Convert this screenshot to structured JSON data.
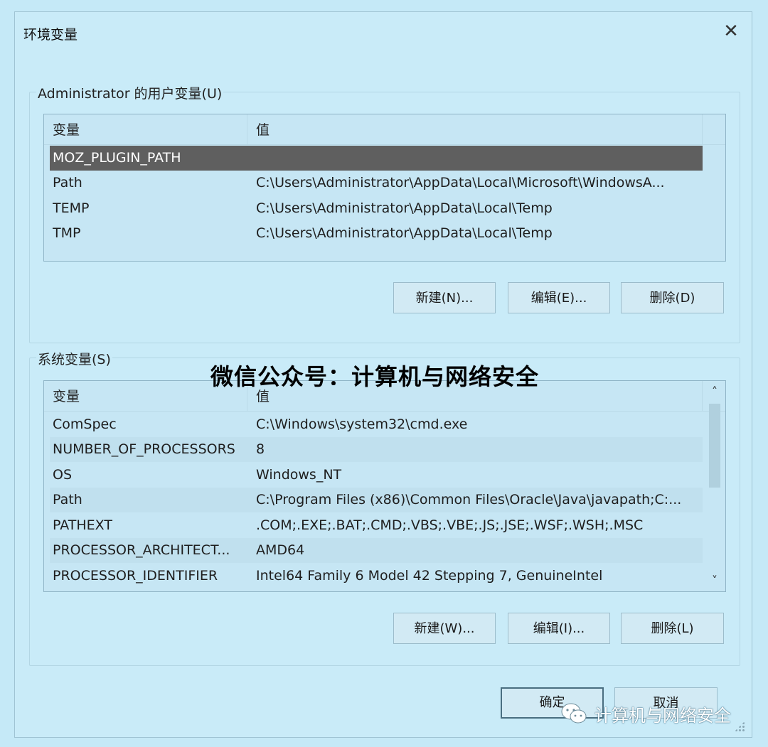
{
  "window": {
    "title": "环境变量",
    "close_glyph": "✕"
  },
  "user_vars": {
    "group_label": "Administrator 的用户变量(U)",
    "headers": [
      "变量",
      "值"
    ],
    "rows": [
      {
        "name": "MOZ_PLUGIN_PATH",
        "value": "",
        "selected": true
      },
      {
        "name": "Path",
        "value": "C:\\Users\\Administrator\\AppData\\Local\\Microsoft\\WindowsA..."
      },
      {
        "name": "TEMP",
        "value": "C:\\Users\\Administrator\\AppData\\Local\\Temp"
      },
      {
        "name": "TMP",
        "value": "C:\\Users\\Administrator\\AppData\\Local\\Temp"
      }
    ],
    "buttons": {
      "new": "新建(N)...",
      "edit": "编辑(E)...",
      "delete": "删除(D)"
    }
  },
  "system_vars": {
    "group_label": "系统变量(S)",
    "headers": [
      "变量",
      "值"
    ],
    "rows": [
      {
        "name": "ComSpec",
        "value": "C:\\Windows\\system32\\cmd.exe"
      },
      {
        "name": "NUMBER_OF_PROCESSORS",
        "value": "8"
      },
      {
        "name": "OS",
        "value": "Windows_NT"
      },
      {
        "name": "Path",
        "value": "C:\\Program Files (x86)\\Common Files\\Oracle\\Java\\javapath;C:..."
      },
      {
        "name": "PATHEXT",
        "value": ".COM;.EXE;.BAT;.CMD;.VBS;.VBE;.JS;.JSE;.WSF;.WSH;.MSC"
      },
      {
        "name": "PROCESSOR_ARCHITECT...",
        "value": "AMD64"
      },
      {
        "name": "PROCESSOR_IDENTIFIER",
        "value": "Intel64 Family 6 Model 42 Stepping 7, GenuineIntel"
      }
    ],
    "scroll_up_glyph": "˄",
    "scroll_down_glyph": "˅",
    "buttons": {
      "new": "新建(W)...",
      "edit": "编辑(I)...",
      "delete": "删除(L)"
    }
  },
  "footer": {
    "ok": "确定",
    "cancel": "取消"
  },
  "overlays": {
    "center_watermark": "微信公众号：计算机与网络安全",
    "bottom_watermark": "计算机与网络安全"
  },
  "icons": [
    "close-icon",
    "scroll-up-icon",
    "scroll-down-icon",
    "wechat-icon",
    "resize-grip-icon"
  ]
}
